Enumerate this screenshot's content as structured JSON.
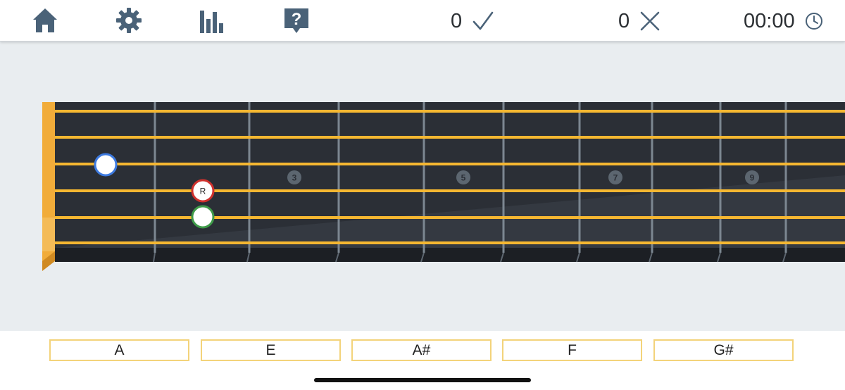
{
  "toolbar": {
    "icons": [
      "home-icon",
      "gear-icon",
      "stats-icon",
      "help-icon",
      "checkmark-icon",
      "cross-icon",
      "clock-icon"
    ],
    "icon_color": "#4a6278",
    "correct_count": "0",
    "wrong_count": "0",
    "timer": "00:00"
  },
  "fretboard": {
    "fret_markers": [
      "3",
      "5",
      "7",
      "9"
    ],
    "root_label": "R",
    "strings_color": "#f5b731",
    "board_color": "#2b2f36",
    "nut_color": "#f1ac3a",
    "note_marker_colors": {
      "open_string_marker": "#3d7ae0",
      "root_marker": "#d0312d",
      "target_marker": "#3e9a48"
    }
  },
  "answers": {
    "options": [
      "A",
      "E",
      "A#",
      "F",
      "G#"
    ],
    "border_color": "#f3d37a"
  }
}
